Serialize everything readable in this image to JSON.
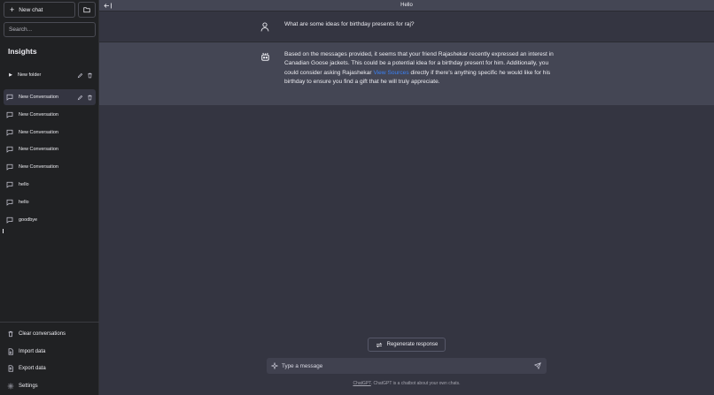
{
  "sidebar": {
    "new_chat_label": "New chat",
    "search_placeholder": "Search...",
    "section_title": "Insights",
    "folder": {
      "label": "New folder"
    },
    "conversations": [
      {
        "label": "New Conversation",
        "active": true
      },
      {
        "label": "New Conversation"
      },
      {
        "label": "New Conversation"
      },
      {
        "label": "New Conversation"
      },
      {
        "label": "New Conversation"
      },
      {
        "label": "hello"
      },
      {
        "label": "hello"
      },
      {
        "label": "goodbye"
      }
    ],
    "footer": {
      "clear_label": "Clear conversations",
      "import_label": "Import data",
      "export_label": "Export data",
      "settings_label": "Settings"
    }
  },
  "header": {
    "title": "Hello"
  },
  "messages": {
    "user_text": "What are some ideas for birthday presents for raj?",
    "bot_text_before_link": "Based on the messages provided, it seems that your friend Rajashekar recently expressed an interest in Canadian Goose jackets. This could be a potential idea for a birthday present for him. Additionally, you could consider asking Rajashekar ",
    "bot_link_text": "View Sources",
    "bot_text_after_link": " directly if there's anything specific he would like for his birthday to ensure you find a gift that he will truly appreciate."
  },
  "composer": {
    "regenerate_label": "Regenerate response",
    "placeholder": "Type a message"
  },
  "footnote": {
    "link_text": "ChatGPT",
    "text": ". ChatGPT is a chatbot about your own chats."
  },
  "colors": {
    "sidebar_bg": "#202123",
    "main_bg": "#343541",
    "bot_bg": "#444654",
    "link": "#3b82f6"
  }
}
